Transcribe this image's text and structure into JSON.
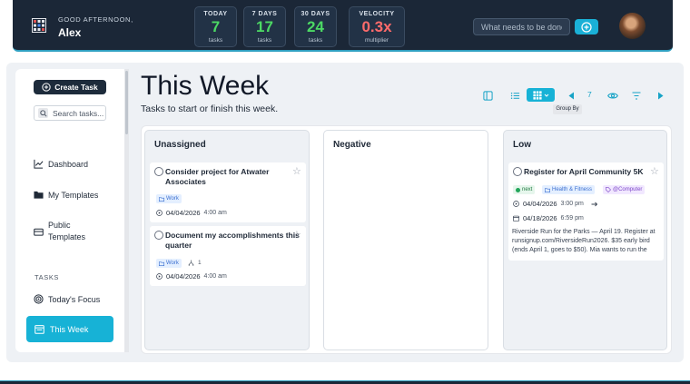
{
  "header": {
    "greeting": "GOOD AFTERNOON,",
    "user_name": "Alex",
    "stats": [
      {
        "label": "TODAY",
        "value": "7",
        "sub": "tasks",
        "color": "#4cd964"
      },
      {
        "label": "7 DAYS",
        "value": "17",
        "sub": "tasks",
        "color": "#4cd964"
      },
      {
        "label": "30 DAYS",
        "value": "24",
        "sub": "tasks",
        "color": "#4cd964"
      },
      {
        "label": "VELOCITY",
        "value": "0.3x",
        "sub": "multiplier",
        "color": "#ff6b6b"
      }
    ],
    "search_placeholder": "What needs to be done?",
    "accent": "#1ab0d6"
  },
  "sidebar": {
    "create_label": "Create Task",
    "search_placeholder": "Search tasks...",
    "items": [
      {
        "label": "Dashboard",
        "icon": "chart-line-icon"
      },
      {
        "label": "My Templates",
        "icon": "folder-icon"
      },
      {
        "label": "Public",
        "label2": "Templates",
        "icon": "inbox-icon"
      }
    ],
    "tasks_heading": "TASKS",
    "task_items": [
      {
        "label": "Today's Focus",
        "icon": "target-icon"
      },
      {
        "label": "This Week",
        "icon": "calendar-week-icon",
        "active": true
      }
    ]
  },
  "main": {
    "title": "This Week",
    "subtitle": "Tasks to start or finish this week.",
    "toolbar": {
      "zoom": "7",
      "tooltip": "Group By"
    },
    "columns": [
      {
        "title": "Unassigned",
        "cards": [
          {
            "title_1": "Consider project for Atwater",
            "title_2": "Associates",
            "tag": "Work",
            "date": "04/04/2026",
            "time": "4:00 am"
          },
          {
            "title_1": "Document my accomplishments this",
            "title_2": "quarter",
            "tag": "Work",
            "subtasks": "1",
            "date": "04/04/2026",
            "time": "4:00 am"
          }
        ]
      },
      {
        "title": "Negative",
        "cards": []
      },
      {
        "title": "Low",
        "cards": [
          {
            "title_1": "Register for April Community 5K",
            "tags": [
              "next",
              "Health & Fitness",
              "@Computer"
            ],
            "start_date": "04/04/2026",
            "start_time": "3:00 pm",
            "due_date": "04/18/2026",
            "due_time": "6:59 pm",
            "desc_1": "Riverside Run for the Parks — April 19. Register at",
            "desc_2": "runsignup.com/RiversideRun2026. $35 early bird",
            "desc_3": "(ends April 1, goes to $50). Mia wants to run the"
          }
        ]
      }
    ]
  }
}
